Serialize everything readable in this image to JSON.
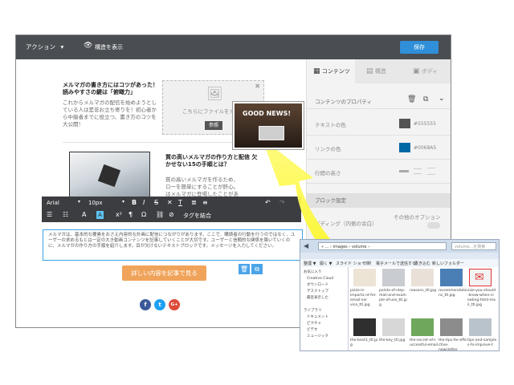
{
  "topbar": {
    "action_label": "アクション",
    "view_structure_label": "構造を表示",
    "save_label": "保存"
  },
  "panel": {
    "tabs": [
      "コンテンツ",
      "構造",
      "ボディ"
    ],
    "properties_title": "コンテンツのプロパティ",
    "text_color_label": "テキストの色",
    "text_color_hex": "#555555",
    "link_color_label": "リンクの色",
    "link_color_hex": "#0068A5",
    "line_height_label": "行間の高さ",
    "block_settings_label": "ブロック設定",
    "padding_label": "パディング（内側の余白）",
    "other_options_label": "その他のオプション"
  },
  "content": {
    "block1_heading": "メルマガの書き方にはコツがあった！読みやすさの鍵は「俯瞰力」",
    "block1_text": "これからメルマガの配信を始めようとしている人は是非お立ち寄りを！初心者から中級者までに役立つ、書き方のコツを大公開！",
    "upload_hint": "こちらにファイルをドロ",
    "browse_label": "参照",
    "block2_heading": "質の高いメルマガの作り方と配信 欠かせない15の手順とは？",
    "block2_text": "質の高いメルマガを作るため、ローを簡単にすることが肝心。はメルマガに登場したことがあ",
    "edit_text": "メルマガは、基本的な要素をおさえ内容的な計画に配信につながりがあります。ここで、購読者の行動を行うのではなく、ユーザーの求めるもとは一定の大き動画コンテンツを記事していくことが大切です。ユーザーと信頼的な関係を築いていくのに、メルマガの作り方の手順を紹介します。目が欠けないテキストブロックです。メッセージを入力してください。",
    "cta_label": "詳しい内容を記事で見る",
    "thumb_label": "GOOD NEWS!"
  },
  "toolbar": {
    "font": "Arial",
    "size": "10px",
    "merge_tags": "タグを結合"
  },
  "social": [
    "f",
    "t",
    "G+"
  ],
  "explorer": {
    "breadcrumb": "« ... › images › volume ›",
    "search_placeholder": "volume...を検索",
    "menu": [
      "整理 ▼",
      "開く ▼",
      "スライド ショー",
      "印刷",
      "電子メールで送信する",
      "書き込む",
      "新しいフォルダー"
    ],
    "sidebar": [
      "お気に入り",
      "Creative Cloud",
      "ダウンロード",
      "デスクトップ",
      "最近表示した",
      "ライブラリ",
      "ドキュメント",
      "ピクチャ",
      "ビデオ",
      "ミュージック"
    ],
    "files": [
      [
        "pizza-is-importa nt-for-email-ser vice_ttl.jpg",
        "points-of-step- mail-and-exam ple-of-use_ttl.jp g",
        "reasons_ttl.jpg",
        "recommendatio ns_ttl.jpg",
        "size-you-should -know-when-cr eating-html-ma il_ttl.jpg"
      ],
      [
        "the-best3_ttl.jp g",
        "the-key_ttl.jpg",
        "the-secret-of-s uccessful-email",
        "the-tips-for-effe ctive-newsletter",
        "tips-and-sample s-fo-improve-t"
      ]
    ]
  }
}
